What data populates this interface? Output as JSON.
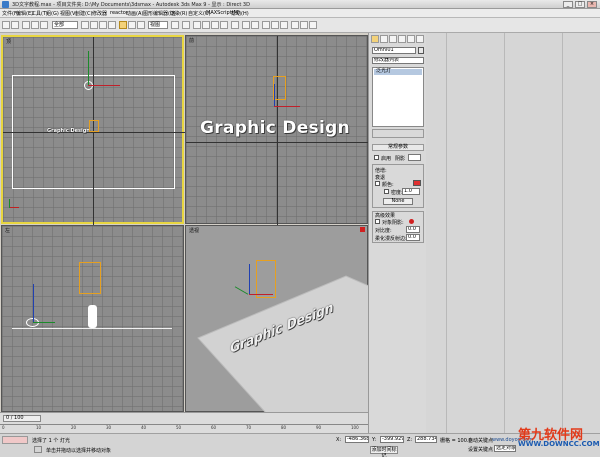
{
  "window": {
    "title": "3D文字教程.max    - 项目文件夹: D:\\My Documents\\3dsmax    - Autodesk 3ds Max 9    - 显示 : Direct 3D",
    "minimize": "_",
    "maximize": "□",
    "close": "×"
  },
  "menus": [
    "文件(F)",
    "编辑(E)",
    "工具(T)",
    "组(G)",
    "视图(V)",
    "创建(C)",
    "修改器",
    "reactor",
    "动画(A)",
    "图形编辑器(D)",
    "渲染(R)",
    "自定义(U)",
    "MAXScript(M)",
    "帮助(H)"
  ],
  "toolbar": {
    "selection_filter": "全部",
    "reference_coord": "视图"
  },
  "viewports": {
    "top": {
      "label": "顶"
    },
    "front": {
      "label": "前"
    },
    "left": {
      "label": "左"
    },
    "perspective": {
      "label": "透视"
    }
  },
  "scene_text": "Graphic Design",
  "command_panel": {
    "object_name": "Omni01",
    "modifier_list": "修改器列表",
    "stack_item": "泛光灯",
    "rollout_general": "常规参数",
    "on_label": "启用",
    "shadow_type_label": "阴影",
    "exclude_label": "排除...",
    "intensity_rollout": "强度/颜色/衰减",
    "multiplier_label": "倍增:",
    "multiplier_value": "1.0",
    "decay_label": "衰退",
    "decay_type": "无",
    "start_label": "开始:",
    "start_value": "40.0",
    "rollout_advanced": "高级效果",
    "contrast_label": "对比度:",
    "contrast_value": "0.0",
    "soften_label": "柔化漫反射边:",
    "soften_value": "0.0",
    "shadow_params": "阴影参数",
    "obj_shadow": "对象阴影:",
    "color_label": "颜色:",
    "dens_label": "密度:",
    "dens_value": "1.0",
    "map_btn": "贴图:",
    "none_btn": "None"
  },
  "timeline": {
    "frame_counter": "0 / 100",
    "ticks": [
      "0",
      "10",
      "20",
      "30",
      "40",
      "50",
      "60",
      "70",
      "80",
      "90",
      "100"
    ]
  },
  "status": {
    "selection": "选择了 1 个 灯光",
    "prompt": "单击并拖动以选择并移动对象",
    "x_label": "X:",
    "x_value": "-486.368",
    "y_label": "Y:",
    "y_value": "-399.929",
    "z_label": "Z:",
    "z_value": "288.734",
    "grid": "栅格 = 100.0",
    "autokey": "自动关键点",
    "setkey": "设置关键点",
    "selected_dropdown": "选定对象",
    "key_filters": "关键点过滤器...",
    "add_time_tag": "添加时间标记"
  },
  "watermark": {
    "main": "第九软件网",
    "sub": "WWW.DOWNCC.COM",
    "site": "www.doyod.com"
  }
}
